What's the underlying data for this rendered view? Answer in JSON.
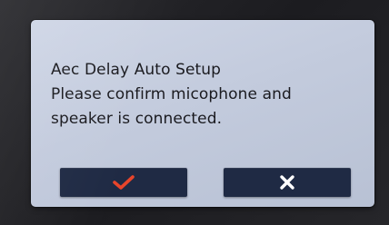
{
  "dialog": {
    "lines": [
      "Aec Delay Auto Setup",
      "Please confirm micophone and",
      "speaker is connected."
    ]
  },
  "buttons": {
    "confirm": {
      "icon": "check-icon",
      "color": "#e8452b"
    },
    "cancel": {
      "icon": "close-icon",
      "color": "#ffffff"
    }
  },
  "colors": {
    "dialog_bg": "#c3cbdd",
    "button_bg": "#1f2a44",
    "text": "#1a1a1f"
  }
}
